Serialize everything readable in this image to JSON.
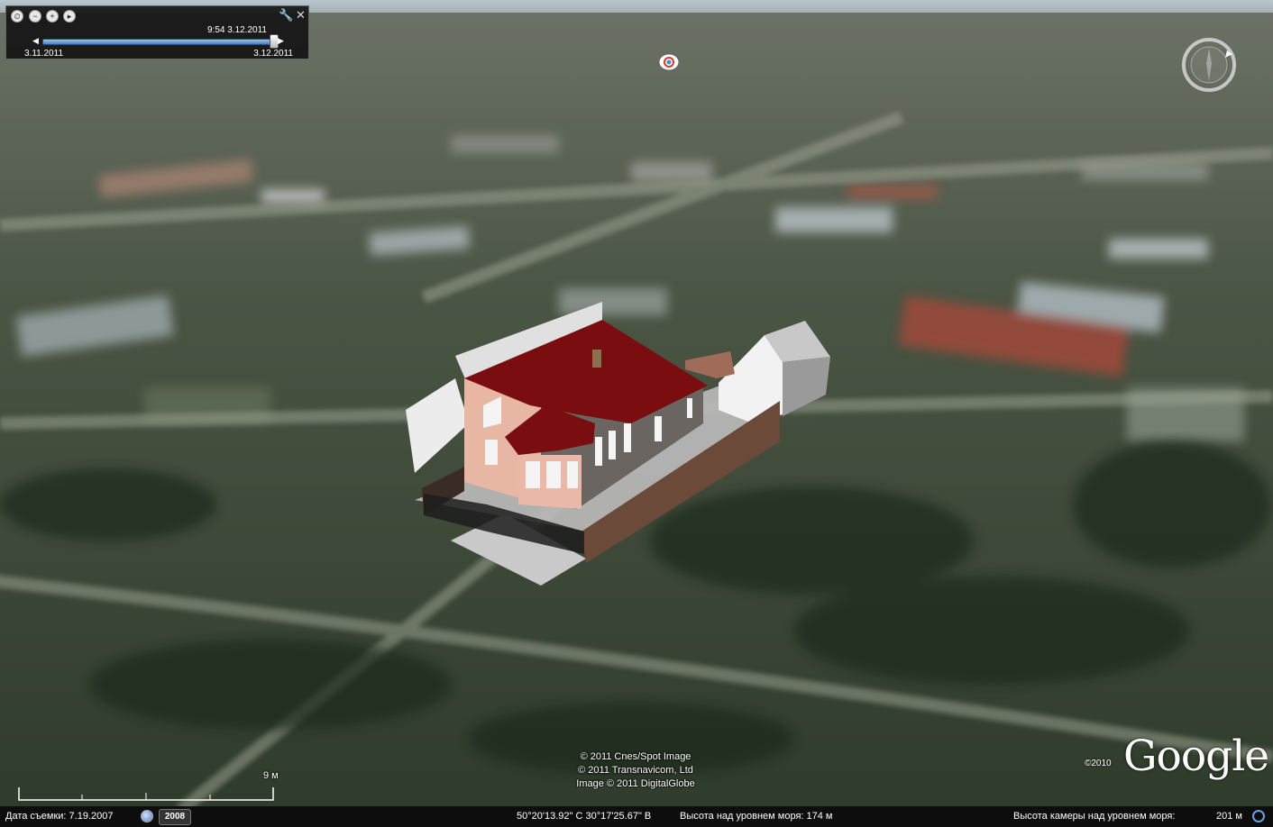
{
  "time_slider": {
    "current_label": "9:54 3.12.2011",
    "start_label": "3.11.2011",
    "end_label": "3.12.2011",
    "progress": 0.98,
    "buttons": [
      "clock-icon",
      "zoom-out-time-icon",
      "zoom-in-time-icon",
      "animate-icon"
    ],
    "settings_icon": "wrench-icon",
    "close_icon": "close-icon"
  },
  "attribution": {
    "line1": "© 2011 Cnes/Spot Image",
    "line2": "© 2011 Transnavicom, Ltd",
    "line3": "Image © 2011 DigitalGlobe"
  },
  "logo": {
    "text": "Google",
    "year": "©2010"
  },
  "scale": {
    "label": "9 м"
  },
  "status": {
    "imagery_date_label": "Дата съемки: 7.19.2007",
    "history_year": "2008",
    "coordinates": "50°20'13.92\" С   30°17'25.67\" В",
    "elevation": "Высота над уровнем моря:  174 м",
    "camera_altitude_label": "Высота камеры над уровнем моря:",
    "camera_altitude_value": "201 м"
  },
  "colors": {
    "roof": "#7a0d10",
    "wall": "#e9bba6",
    "status_bg": "#0d0d0d"
  }
}
